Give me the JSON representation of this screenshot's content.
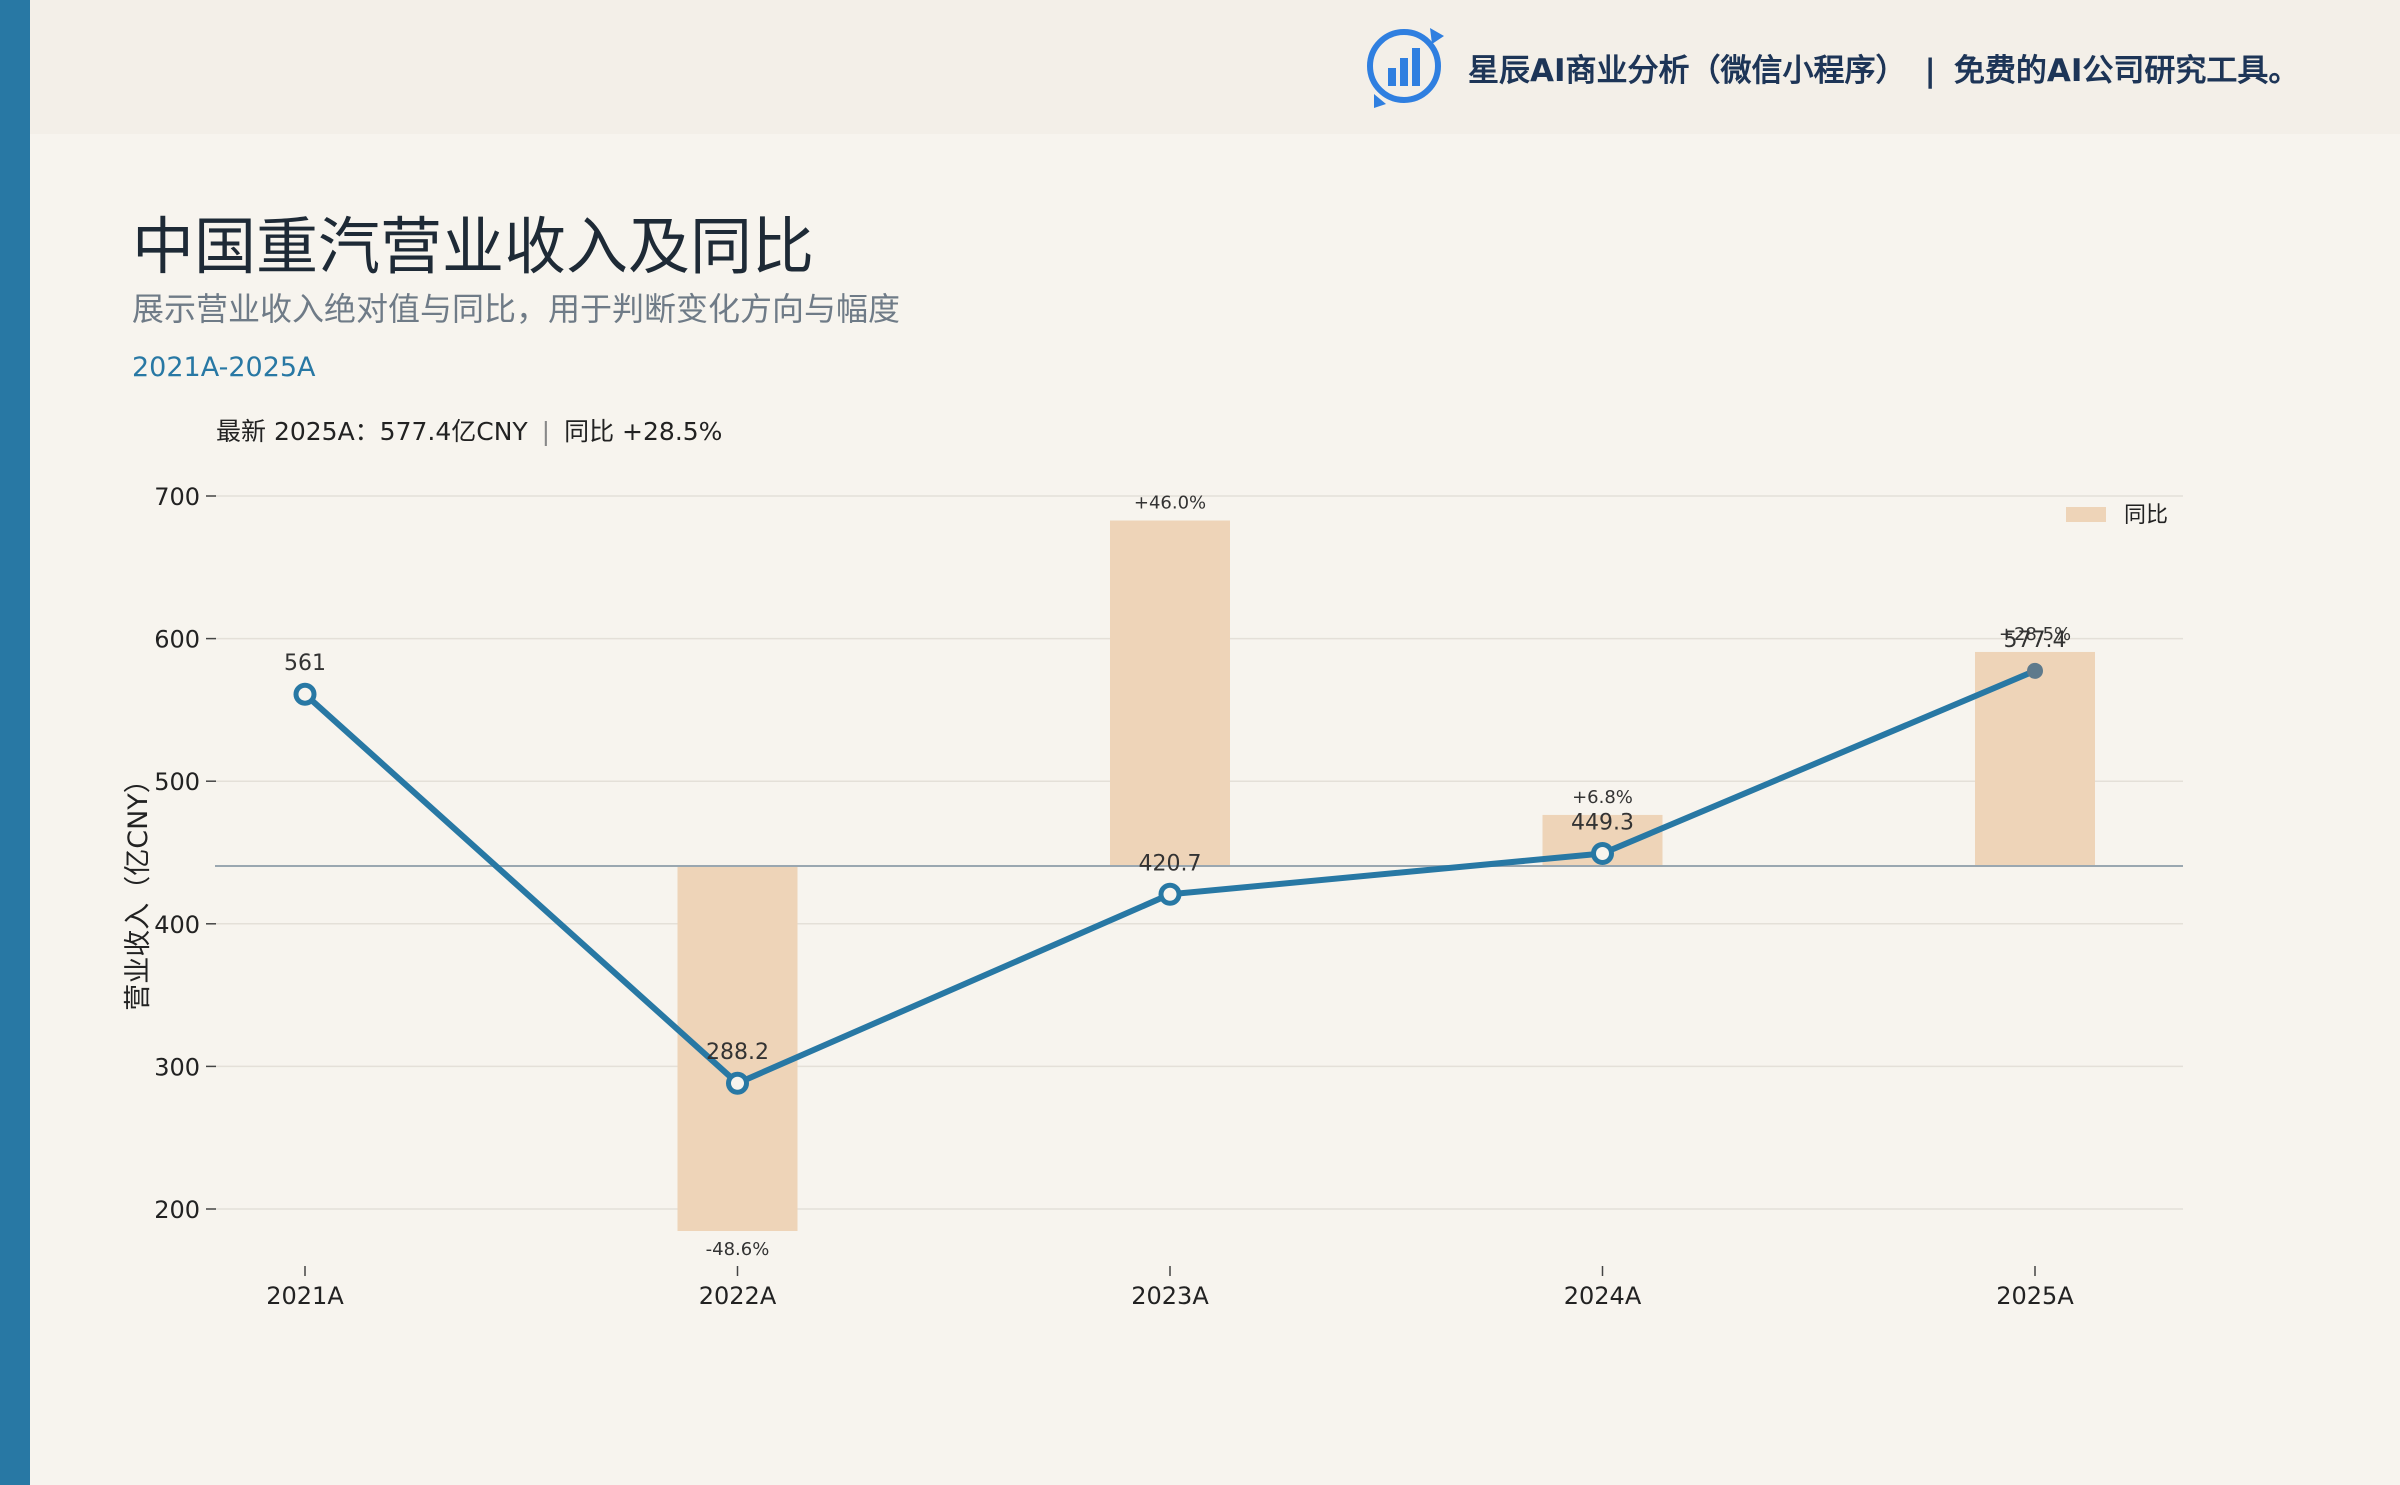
{
  "header": {
    "brand_name": "星辰AI商业分析（微信小程序）",
    "separator": "|",
    "tagline": "免费的AI公司研究工具。",
    "logo_icon": "bar-chart-refresh-icon"
  },
  "page": {
    "title": "中国重汽营业收入及同比",
    "subtitle": "展示营业收入绝对值与同比，用于判断变化方向与幅度",
    "period": "2021A-2025A",
    "summary_latest": "最新 2025A：577.4亿CNY",
    "summary_sep": "|",
    "summary_yoy": "同比 +28.5%"
  },
  "colors": {
    "accent": "#2878a4",
    "bar": "#eed4b8",
    "last_point": "#5e7a8c"
  },
  "chart_data": {
    "type": "bar+line",
    "categories": [
      "2021A",
      "2022A",
      "2023A",
      "2024A",
      "2025A"
    ],
    "series": [
      {
        "name": "",
        "kind": "line",
        "values": [
          561,
          288.2,
          420.7,
          449.3,
          577.4
        ],
        "labels": [
          "561",
          "288.2",
          "420.7",
          "449.3",
          "577.4"
        ]
      },
      {
        "name": "同比",
        "kind": "bar",
        "values": [
          null,
          -48.6,
          46.0,
          6.8,
          28.5
        ],
        "labels": [
          "",
          "-48.6%",
          "+46.0%",
          "+6.8%",
          "+28.5%"
        ]
      }
    ],
    "ylabel": "营业收入（亿CNY）",
    "xlabel": "",
    "ylim": [
      160,
      720
    ],
    "yticks": [
      200,
      300,
      400,
      500,
      600,
      700
    ],
    "legend": {
      "position": "top-right",
      "entries": [
        "同比"
      ]
    },
    "grid": true
  }
}
